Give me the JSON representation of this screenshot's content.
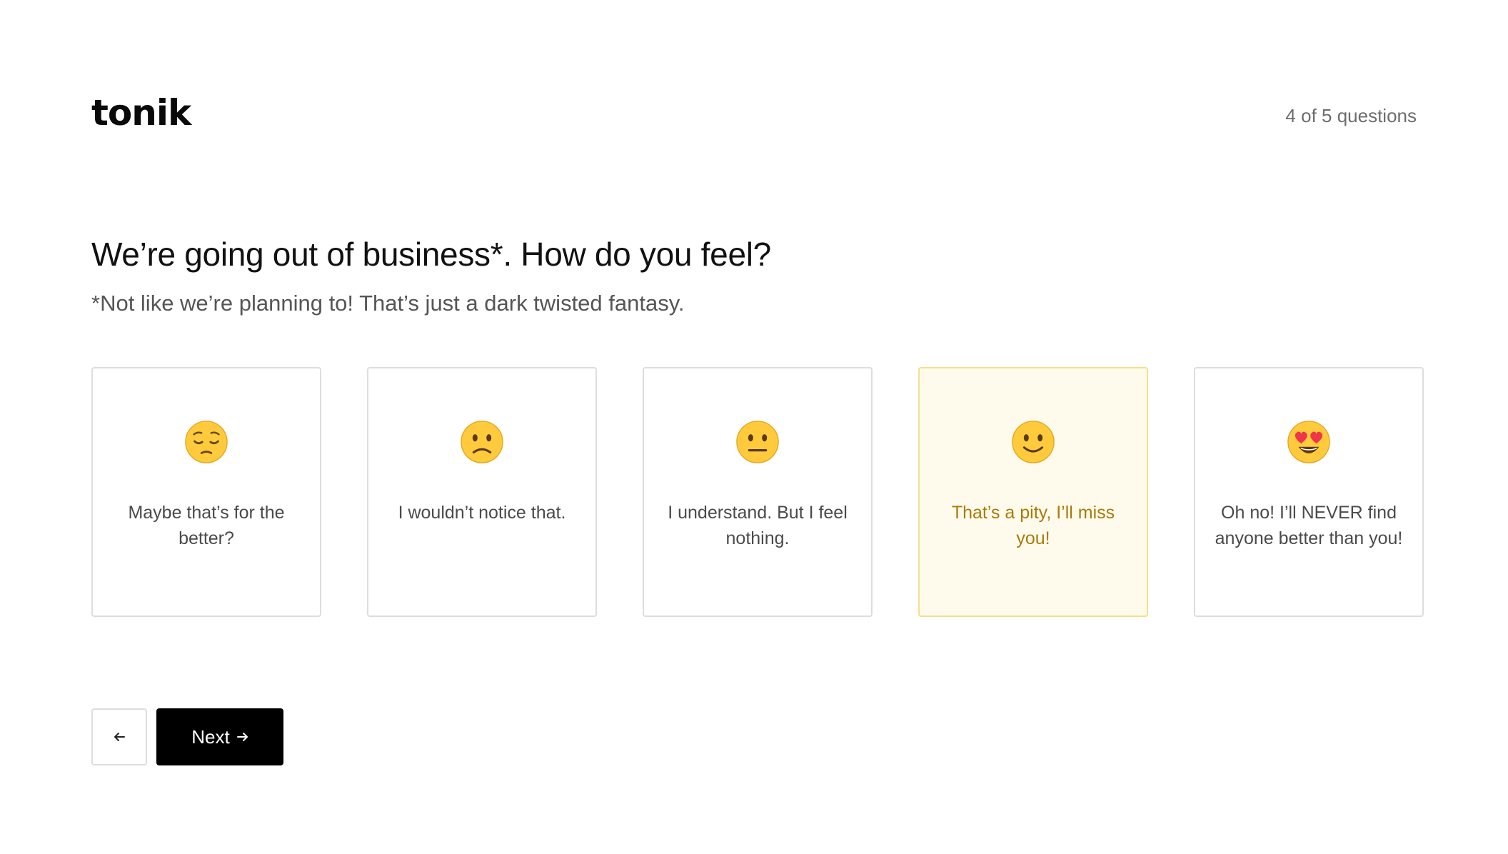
{
  "header": {
    "logo_text": "tonik",
    "progress_text": "4 of 5 questions"
  },
  "question": {
    "title": "We’re going out of business*. How do you feel?",
    "subtitle": "*Not like we’re planning to! That’s just a dark twisted fantasy."
  },
  "options": [
    {
      "emoji": "pensive-face-icon",
      "label": "Maybe that’s for the better?",
      "selected": false
    },
    {
      "emoji": "slightly-frowning-face-icon",
      "label": "I wouldn’t notice that.",
      "selected": false
    },
    {
      "emoji": "neutral-face-icon",
      "label": "I understand. But I feel nothing.",
      "selected": false
    },
    {
      "emoji": "slightly-smiling-face-icon",
      "label": "That’s a pity, I’ll miss you!",
      "selected": true
    },
    {
      "emoji": "heart-eyes-face-icon",
      "label": "Oh no! I’ll NEVER find anyone better than you!",
      "selected": false
    }
  ],
  "navigation": {
    "back_icon": "arrow-left-icon",
    "next_label": "Next",
    "next_icon": "arrow-right-icon"
  },
  "colors": {
    "emoji_yellow": "#ffcb3d",
    "selected_background": "#fffbec",
    "selected_border": "#f4df8a",
    "selected_text": "#a97a08",
    "heart_red": "#f0344a"
  }
}
